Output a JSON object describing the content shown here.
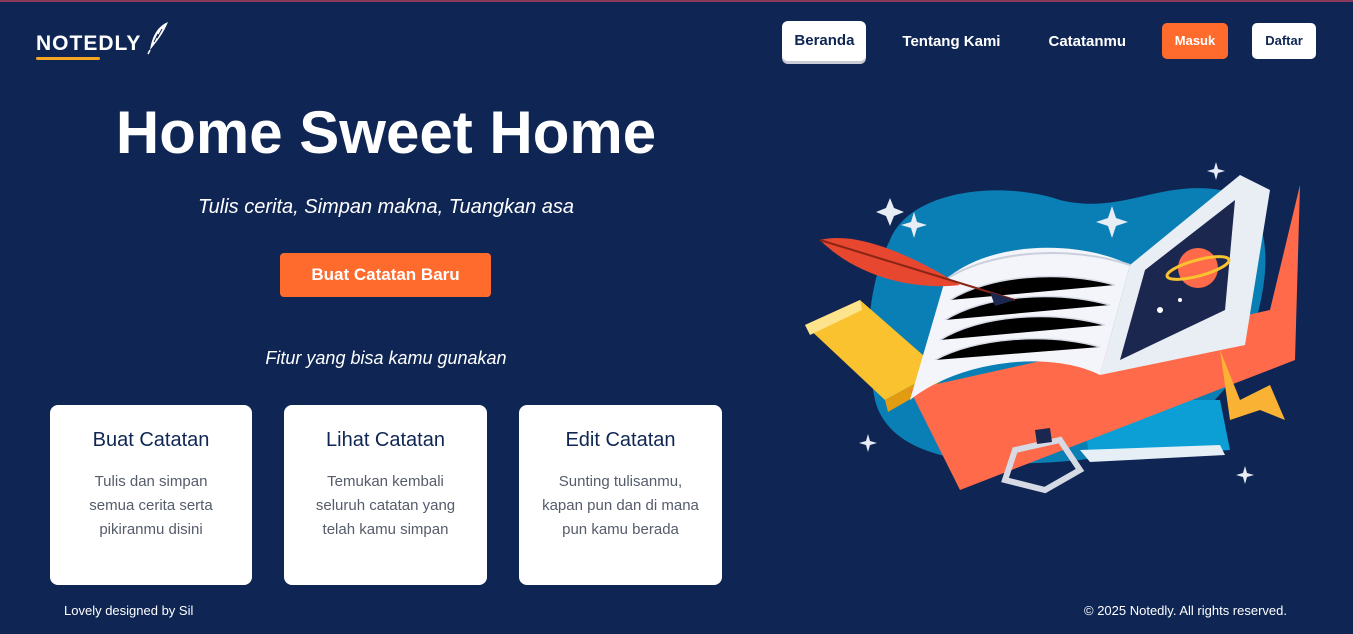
{
  "logo": {
    "text": "NOTEDLY"
  },
  "nav": {
    "items": [
      {
        "label": "Beranda",
        "active": true
      },
      {
        "label": "Tentang Kami"
      },
      {
        "label": "Catatanmu"
      }
    ],
    "login_label": "Masuk",
    "register_label": "Daftar"
  },
  "hero": {
    "title": "Home Sweet Home",
    "subtitle": "Tulis cerita, Simpan makna, Tuangkan asa",
    "cta_label": "Buat Catatan Baru"
  },
  "features": {
    "heading": "Fitur yang bisa kamu gunakan",
    "cards": [
      {
        "title": "Buat Catatan",
        "desc": "Tulis dan simpan semua cerita serta pikiranmu disini"
      },
      {
        "title": "Lihat Catatan",
        "desc": "Temukan kembali seluruh catatan yang telah kamu simpan"
      },
      {
        "title": "Edit Catatan",
        "desc": "Sunting tulisanmu, kapan pun dan di mana pun kamu berada"
      }
    ]
  },
  "footer": {
    "left": "Lovely designed by Sil",
    "right": "© 2025 Notedly. All rights reserved."
  },
  "colors": {
    "background": "#0f2654",
    "accent": "#ff6b2c",
    "logo_underline": "#f5a623",
    "card_bg": "#ffffff"
  },
  "icons": {
    "logo_mark": "quill-icon"
  }
}
